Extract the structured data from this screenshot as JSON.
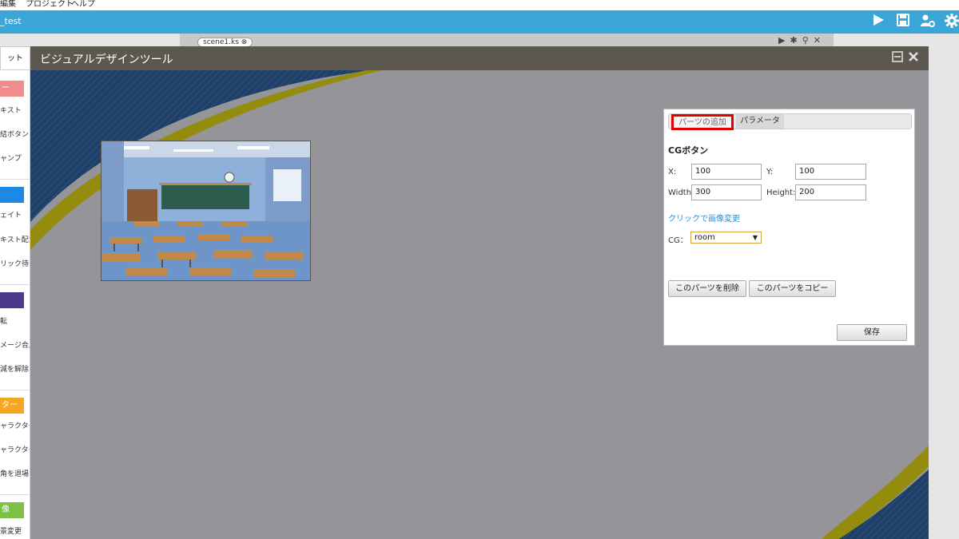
{
  "menubar": {
    "items": [
      {
        "label": "編集"
      },
      {
        "label": "プロジェクト"
      },
      {
        "label": "ヘルプ"
      }
    ]
  },
  "project": {
    "name": "_test"
  },
  "toolbar_icons": [
    "play-icon",
    "save-icon",
    "users-gear-icon",
    "settings-gear-icon"
  ],
  "editor": {
    "tab_label": "scene1.ks"
  },
  "left_tab": {
    "label": "ット"
  },
  "palette": {
    "categories": [
      {
        "label": "ー",
        "color": "#f28b8b",
        "items": [
          "キスト",
          "結ボタン",
          "ャンプ"
        ]
      },
      {
        "label": "",
        "color": "#1e88e5",
        "items": [
          "ェイト",
          "キスト配置",
          "リック待ち"
        ]
      },
      {
        "label": "",
        "color": "#4b3a8c",
        "items": [
          "転",
          "メージ合成",
          "減を解除"
        ]
      },
      {
        "label": "ター",
        "color": "#f5a623",
        "items": [
          "ャラクター",
          "ャラクター",
          "角を退場"
        ]
      },
      {
        "label": "像",
        "color": "#7cc242",
        "items": [
          "景変更"
        ]
      }
    ]
  },
  "dialog": {
    "title": "ビジュアルデザインツール",
    "colors": {
      "canvas_bg": "#959599",
      "navy": "#1f3f66",
      "olive": "#938c0d"
    }
  },
  "panel": {
    "tabs": [
      {
        "label": "パーツの追加"
      },
      {
        "label": "パラメータ"
      }
    ],
    "title": "CGボタン",
    "x_label": "X:",
    "x_value": "100",
    "y_label": "Y:",
    "y_value": "100",
    "width_label": "Width:",
    "width_value": "300",
    "height_label": "Height:",
    "height_value": "200",
    "link": "クリックで画像変更",
    "cg_label": "CG：",
    "cg_value": "room",
    "delete_button": "このパーツを削除",
    "copy_button": "このパーツをコピー",
    "save_button": "保存"
  }
}
